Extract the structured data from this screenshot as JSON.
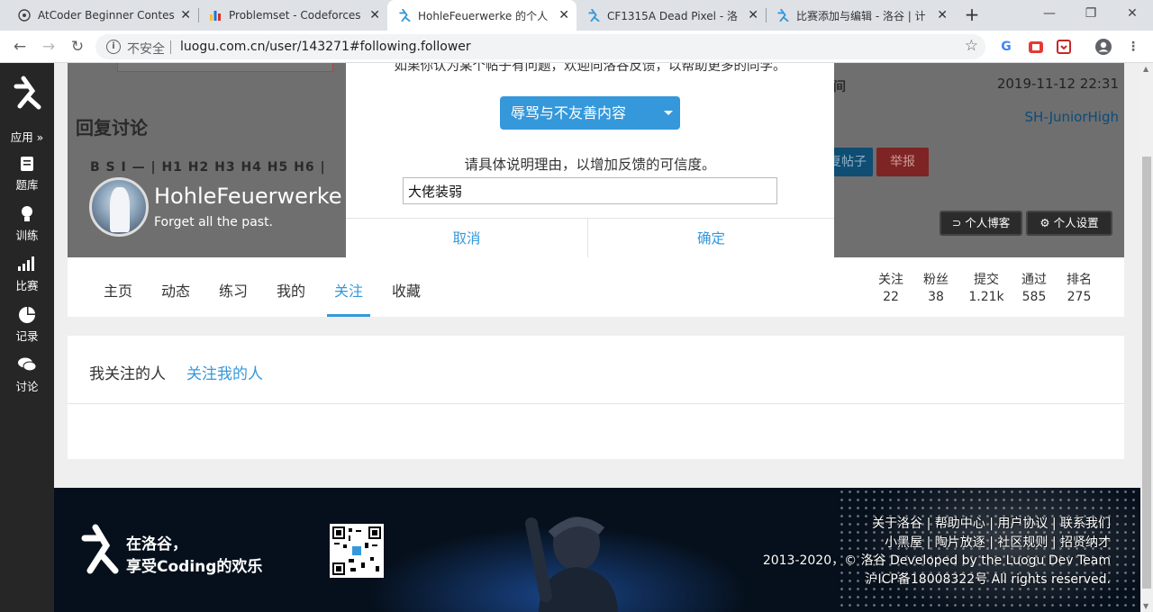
{
  "browser": {
    "tabs": [
      {
        "title": "AtCoder Beginner Contes",
        "icon": "atcoder-favicon",
        "active": false
      },
      {
        "title": "Problemset - Codeforces",
        "icon": "codeforces-favicon",
        "active": false
      },
      {
        "title": "HohleFeuerwerke 的个人",
        "icon": "luogu-favicon",
        "active": true
      },
      {
        "title": "CF1315A Dead Pixel - 洛",
        "icon": "luogu-favicon",
        "active": false
      },
      {
        "title": "比赛添加与编辑 - 洛谷 | 计",
        "icon": "luogu-favicon",
        "active": false
      }
    ],
    "insecure_label": "不安全",
    "url": "luogu.com.cn/user/143271#following.follower"
  },
  "sidebar": {
    "items": [
      {
        "label": "应用 »",
        "icon": "apps-icon"
      },
      {
        "label": "题库",
        "icon": "book-icon"
      },
      {
        "label": "训练",
        "icon": "lightbulb-icon"
      },
      {
        "label": "比赛",
        "icon": "bar-chart-icon"
      },
      {
        "label": "记录",
        "icon": "pie-chart-icon"
      },
      {
        "label": "讨论",
        "icon": "chat-icon"
      }
    ]
  },
  "background_post": {
    "reply_title": "回复讨论",
    "toolbar": "B S I — | H1 H2 H3 H4 H5 H6 |",
    "time_label": "时间",
    "time_value": "2019-11-12 22:31",
    "school": "SH-JuniorHigh",
    "reply_button": "复帖子",
    "report_button": "举报"
  },
  "profile": {
    "username": "HohleFeuerwerke",
    "motto": "Forget all the past.",
    "blog_button": "个人博客",
    "settings_button": "个人设置"
  },
  "dialog": {
    "hint": "如果你认为某个帖子有问题，欢迎向洛谷反馈，以帮助更多的同学。",
    "category": "辱骂与不友善内容",
    "explain": "请具体说明理由，以增加反馈的可信度。",
    "reason_value": "大佬装弱",
    "cancel": "取消",
    "confirm": "确定"
  },
  "nav": {
    "tabs": [
      "主页",
      "动态",
      "练习",
      "我的",
      "关注",
      "收藏"
    ],
    "active_tab": "关注",
    "stats": [
      {
        "label": "关注",
        "value": "22"
      },
      {
        "label": "粉丝",
        "value": "38"
      },
      {
        "label": "提交",
        "value": "1.21k"
      },
      {
        "label": "通过",
        "value": "585"
      },
      {
        "label": "排名",
        "value": "275"
      }
    ]
  },
  "follow": {
    "following_tab": "我关注的人",
    "followers_tab": "关注我的人"
  },
  "footer": {
    "slogan_line1": "在洛谷，",
    "slogan_line2": "享受Coding的欢乐",
    "links_line1": "关于洛谷 | 帮助中心 | 用户协议 | 联系我们",
    "links_line2": "小黑屋 | 陶片放逐 | 社区规则 | 招贤纳才",
    "copyright": "2013-2020，© 洛谷 Developed by the Luogu Dev Team",
    "icp": "沪ICP备18008322号 All rights reserved."
  },
  "colors": {
    "accent": "#3498db",
    "sidebar_bg": "#262626",
    "report_red": "#e74c3c"
  }
}
